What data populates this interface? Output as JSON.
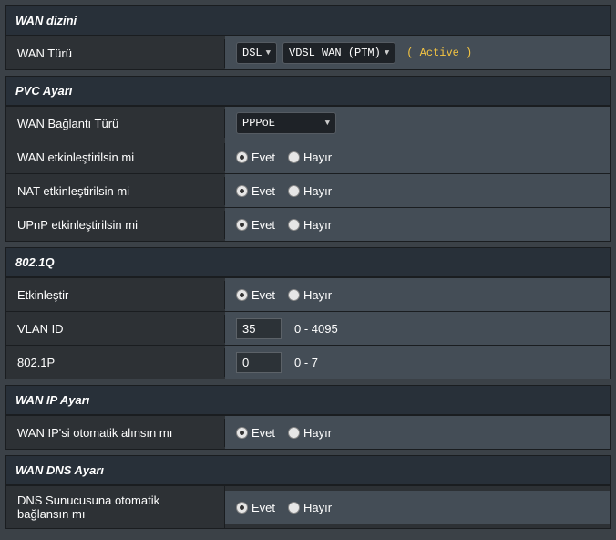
{
  "wanIndex": {
    "title": "WAN dizini",
    "rows": {
      "wanType": {
        "label": "WAN Türü",
        "select1": "DSL",
        "select2": "VDSL WAN (PTM)",
        "active": "( Active )"
      }
    }
  },
  "pvc": {
    "title": "PVC Ayarı",
    "connType": {
      "label": "WAN Bağlantı Türü",
      "value": "PPPoE"
    },
    "wanEnable": {
      "label": "WAN etkinleştirilsin mi",
      "value": "Evet"
    },
    "natEnable": {
      "label": "NAT etkinleştirilsin mi",
      "value": "Evet"
    },
    "upnpEnable": {
      "label": "UPnP etkinleştirilsin mi",
      "value": "Evet"
    }
  },
  "dot1q": {
    "title": "802.1Q",
    "enable": {
      "label": "Etkinleştir",
      "value": "Evet"
    },
    "vlan": {
      "label": "VLAN ID",
      "value": "35",
      "range": "0 - 4095"
    },
    "prio": {
      "label": "802.1P",
      "value": "0",
      "range": "0 - 7"
    }
  },
  "wanIp": {
    "title": "WAN IP Ayarı",
    "auto": {
      "label": "WAN IP'si otomatik alınsın mı",
      "value": "Evet"
    }
  },
  "wanDns": {
    "title": "WAN DNS Ayarı",
    "auto": {
      "label": "DNS Sunucusuna otomatik bağlansın mı",
      "value": "Evet"
    }
  },
  "common": {
    "yes": "Evet",
    "no": "Hayır"
  }
}
